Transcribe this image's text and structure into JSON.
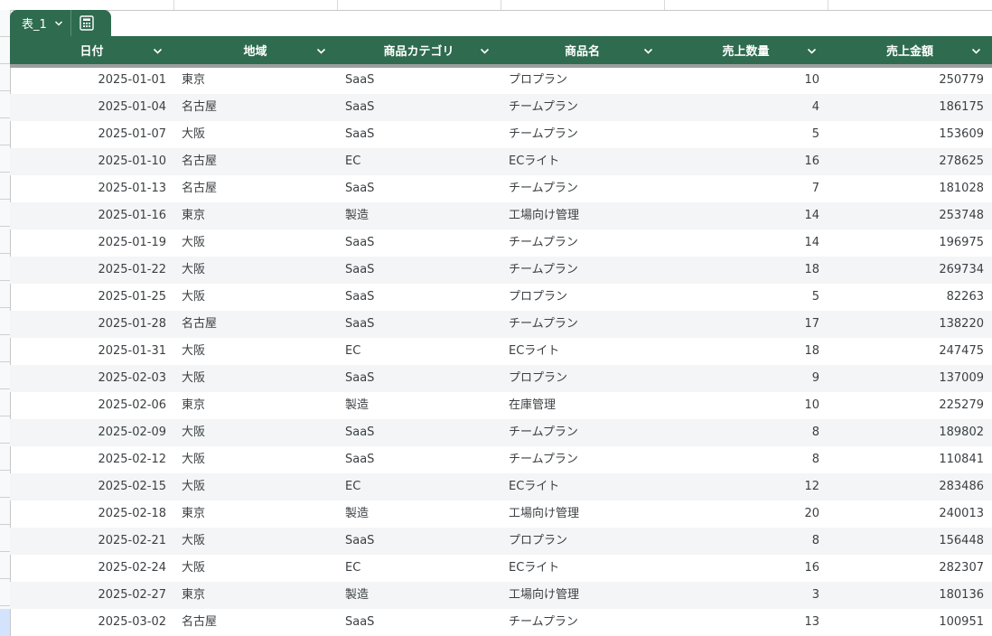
{
  "table_tab": {
    "name": "表_1",
    "chevron_icon": "chevron-down-icon",
    "calc_icon": "calculator-icon"
  },
  "header": {
    "columns": [
      {
        "label": "日付"
      },
      {
        "label": "地域"
      },
      {
        "label": "商品カテゴリ"
      },
      {
        "label": "商品名"
      },
      {
        "label": "売上数量"
      },
      {
        "label": "売上金額"
      }
    ]
  },
  "colors": {
    "header_bg": "#2e6b4f",
    "header_text": "#ffffff",
    "alt_row": "#f3f5f6"
  },
  "rows": [
    [
      "2025-01-01",
      "東京",
      "SaaS",
      "プロプラン",
      "10",
      "250779"
    ],
    [
      "2025-01-04",
      "名古屋",
      "SaaS",
      "チームプラン",
      "4",
      "186175"
    ],
    [
      "2025-01-07",
      "大阪",
      "SaaS",
      "チームプラン",
      "5",
      "153609"
    ],
    [
      "2025-01-10",
      "名古屋",
      "EC",
      "ECライト",
      "16",
      "278625"
    ],
    [
      "2025-01-13",
      "名古屋",
      "SaaS",
      "チームプラン",
      "7",
      "181028"
    ],
    [
      "2025-01-16",
      "東京",
      "製造",
      "工場向け管理",
      "14",
      "253748"
    ],
    [
      "2025-01-19",
      "大阪",
      "SaaS",
      "チームプラン",
      "14",
      "196975"
    ],
    [
      "2025-01-22",
      "大阪",
      "SaaS",
      "チームプラン",
      "18",
      "269734"
    ],
    [
      "2025-01-25",
      "大阪",
      "SaaS",
      "プロプラン",
      "5",
      "82263"
    ],
    [
      "2025-01-28",
      "名古屋",
      "SaaS",
      "チームプラン",
      "17",
      "138220"
    ],
    [
      "2025-01-31",
      "大阪",
      "EC",
      "ECライト",
      "18",
      "247475"
    ],
    [
      "2025-02-03",
      "大阪",
      "SaaS",
      "プロプラン",
      "9",
      "137009"
    ],
    [
      "2025-02-06",
      "東京",
      "製造",
      "在庫管理",
      "10",
      "225279"
    ],
    [
      "2025-02-09",
      "大阪",
      "SaaS",
      "チームプラン",
      "8",
      "189802"
    ],
    [
      "2025-02-12",
      "大阪",
      "SaaS",
      "チームプラン",
      "8",
      "110841"
    ],
    [
      "2025-02-15",
      "大阪",
      "EC",
      "ECライト",
      "12",
      "283486"
    ],
    [
      "2025-02-18",
      "東京",
      "製造",
      "工場向け管理",
      "20",
      "240013"
    ],
    [
      "2025-02-21",
      "大阪",
      "SaaS",
      "プロプラン",
      "8",
      "156448"
    ],
    [
      "2025-02-24",
      "大阪",
      "EC",
      "ECライト",
      "16",
      "282307"
    ],
    [
      "2025-02-27",
      "東京",
      "製造",
      "工場向け管理",
      "3",
      "180136"
    ],
    [
      "2025-03-02",
      "名古屋",
      "SaaS",
      "チームプラン",
      "13",
      "100951"
    ]
  ]
}
